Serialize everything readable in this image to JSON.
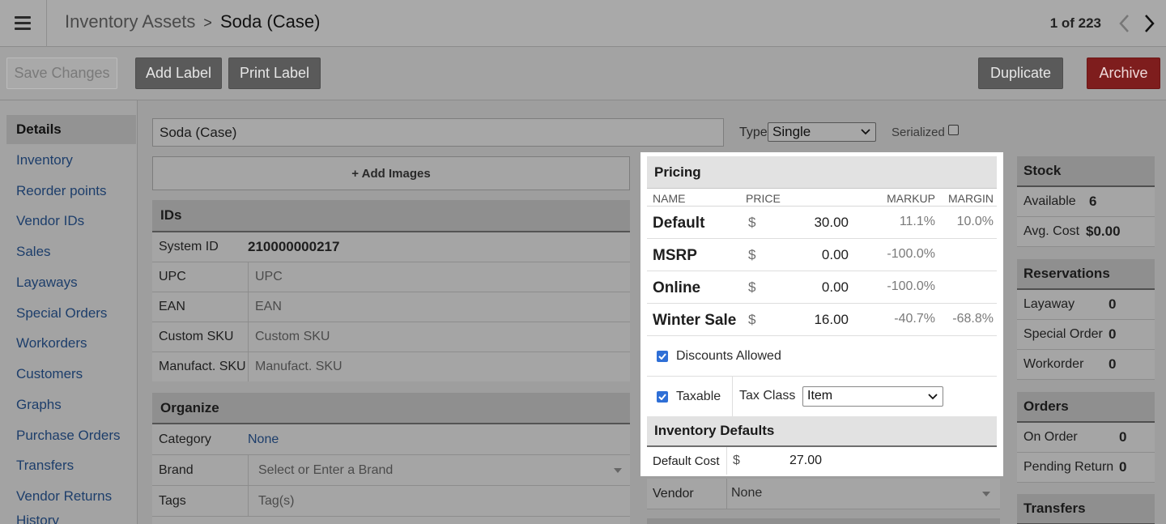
{
  "header": {
    "breadcrumb_parent": "Inventory Assets",
    "breadcrumb_sep": ">",
    "breadcrumb_current": "Soda (Case)",
    "pager_text": "1 of 223"
  },
  "toolbar": {
    "save_label": "Save Changes",
    "add_label": "Add Label",
    "print_label": "Print Label",
    "duplicate_label": "Duplicate",
    "archive_label": "Archive"
  },
  "sidebar": {
    "items": [
      {
        "label": "Details"
      },
      {
        "label": "Inventory"
      },
      {
        "label": "Reorder points"
      },
      {
        "label": "Vendor IDs"
      },
      {
        "label": "Sales"
      },
      {
        "label": "Layaways"
      },
      {
        "label": "Special Orders"
      },
      {
        "label": "Workorders"
      },
      {
        "label": "Customers"
      },
      {
        "label": "Graphs"
      },
      {
        "label": "Purchase Orders"
      },
      {
        "label": "Transfers"
      },
      {
        "label": "Vendor Returns"
      },
      {
        "label": "History"
      }
    ]
  },
  "item": {
    "name_value": "Soda (Case)",
    "type_label": "Type",
    "type_value": "Single",
    "serialized_label": "Serialized",
    "add_images_label": "+ Add Images"
  },
  "ids": {
    "title": "IDs",
    "system_id_label": "System ID",
    "system_id_value": "210000000217",
    "upc_label": "UPC",
    "upc_placeholder": "UPC",
    "ean_label": "EAN",
    "ean_placeholder": "EAN",
    "custom_sku_label": "Custom SKU",
    "custom_sku_placeholder": "Custom SKU",
    "manufact_sku_label": "Manufact. SKU",
    "manufact_sku_placeholder": "Manufact. SKU"
  },
  "organize": {
    "title": "Organize",
    "category_label": "Category",
    "category_value": "None",
    "brand_label": "Brand",
    "brand_placeholder": "Select or Enter a Brand",
    "tags_label": "Tags",
    "tags_placeholder": "Tag(s)"
  },
  "pricing": {
    "title": "Pricing",
    "col_name": "NAME",
    "col_price": "PRICE",
    "col_markup": "MARKUP",
    "col_margin": "MARGIN",
    "rows": [
      {
        "name": "Default",
        "currency": "$",
        "price": "30.00",
        "markup": "11.1%",
        "margin": "10.0%"
      },
      {
        "name": "MSRP",
        "currency": "$",
        "price": "0.00",
        "markup": "-100.0%",
        "margin": ""
      },
      {
        "name": "Online",
        "currency": "$",
        "price": "0.00",
        "markup": "-100.0%",
        "margin": ""
      },
      {
        "name": "Winter Sale",
        "currency": "$",
        "price": "16.00",
        "markup": "-40.7%",
        "margin": "-68.8%"
      }
    ],
    "discounts_label": "Discounts Allowed",
    "taxable_label": "Taxable",
    "tax_class_label": "Tax Class",
    "tax_class_value": "Item"
  },
  "inventory_defaults": {
    "title": "Inventory Defaults",
    "default_cost_label": "Default Cost",
    "currency": "$",
    "default_cost_value": "27.00",
    "vendor_label": "Vendor",
    "vendor_value": "None"
  },
  "stock": {
    "title": "Stock",
    "available_label": "Available",
    "available_value": "6",
    "avg_cost_label": "Avg. Cost",
    "avg_cost_value": "$0.00"
  },
  "reservations": {
    "title": "Reservations",
    "layaway_label": "Layaway",
    "layaway_value": "0",
    "special_order_label": "Special Order",
    "special_order_value": "0",
    "workorder_label": "Workorder",
    "workorder_value": "0"
  },
  "orders": {
    "title": "Orders",
    "on_order_label": "On Order",
    "on_order_value": "0",
    "pending_return_label": "Pending Return",
    "pending_return_value": "0"
  },
  "transfers": {
    "title": "Transfers"
  }
}
